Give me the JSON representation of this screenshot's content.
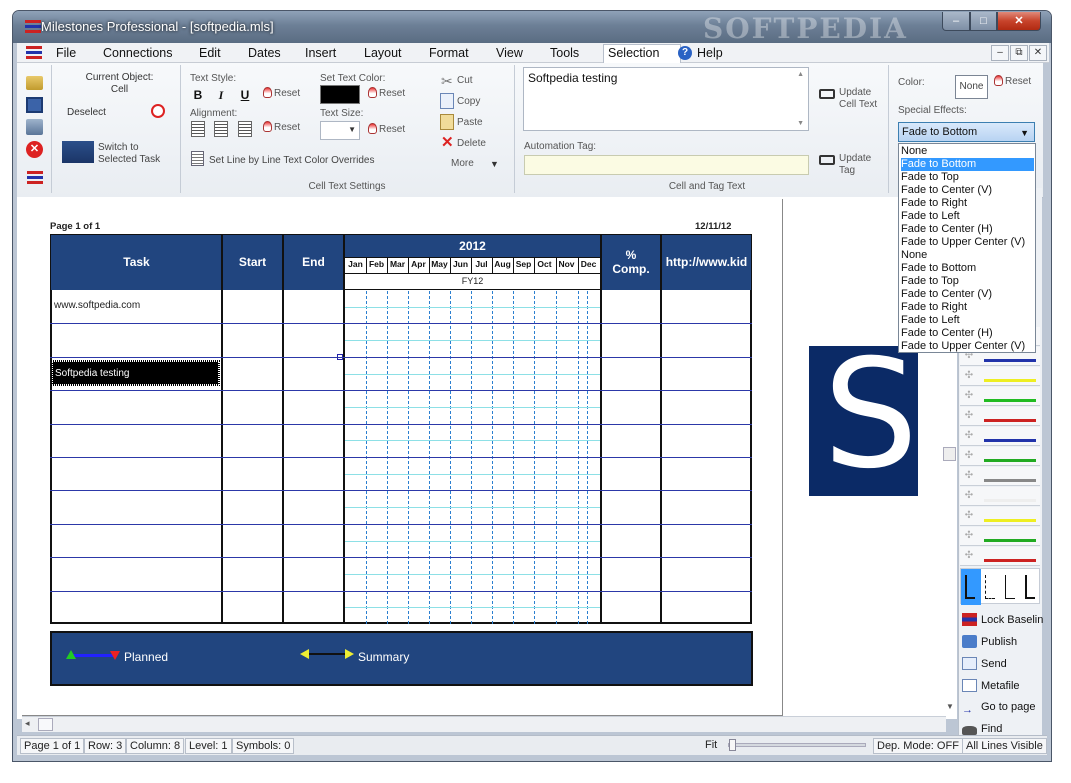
{
  "window": {
    "title": "Milestones Professional - [softpedia.mls]",
    "watermark": "SOFTPEDIA",
    "minimize": "‒",
    "maximize": "□",
    "close": "✕"
  },
  "menu": {
    "items": [
      "File",
      "Connections",
      "Edit",
      "Dates",
      "Insert",
      "Layout",
      "Format",
      "View",
      "Tools",
      "Selection",
      "Help"
    ]
  },
  "ribbon": {
    "current_object_label": "Current Object:",
    "current_object_value": "Cell",
    "deselect": "Deselect",
    "switch_task": [
      "Switch to",
      "Selected Task"
    ],
    "text_style": "Text Style:",
    "bold": "B",
    "italic": "I",
    "underline": "U",
    "reset": "Reset",
    "alignment": "Alignment:",
    "set_text_color": "Set Text Color:",
    "text_size": "Text Size:",
    "cut": "Cut",
    "copy": "Copy",
    "paste": "Paste",
    "delete": "Delete",
    "more": "More",
    "set_line_override": "Set Line by Line Text Color Overrides",
    "group_cell_text": "Cell Text Settings",
    "cell_text": "Softpedia testing",
    "update_cell_text": [
      "Update",
      "Cell Text"
    ],
    "automation_tag": "Automation Tag:",
    "update_tag": [
      "Update",
      "Tag"
    ],
    "group_cell_tag": "Cell and Tag Text",
    "color_label": "Color:",
    "color_value": "None",
    "special_effects": "Special Effects:",
    "special_effect_value": "Fade to Bottom"
  },
  "dropdown": {
    "items": [
      "None",
      "Fade to Bottom",
      "Fade to Top",
      "Fade to Center (V)",
      "Fade to Right",
      "Fade to Left",
      "Fade to Center (H)",
      "Fade to Upper Center (V)",
      "None",
      "Fade to Bottom",
      "Fade to Top",
      "Fade to Center (V)",
      "Fade to Right",
      "Fade to Left",
      "Fade to Center (H)",
      "Fade to Upper Center (V)"
    ],
    "selected_index": 1
  },
  "chart": {
    "page_info": "Page 1 of 1",
    "date": "12/11/12",
    "headers": {
      "task": "Task",
      "start": "Start",
      "end": "End",
      "year": "2012",
      "pct": [
        "%",
        "Comp."
      ],
      "url": "http://www.kid"
    },
    "months": [
      "Jan",
      "Feb",
      "Mar",
      "Apr",
      "May",
      "Jun",
      "Jul",
      "Aug",
      "Sep",
      "Oct",
      "Nov",
      "Dec"
    ],
    "fiscal": "FY12",
    "rows": [
      "www.softpedia.com",
      "",
      "Softpedia testing",
      "",
      "",
      "",
      "",
      "",
      "",
      ""
    ],
    "selected_row": 2,
    "legend": [
      {
        "label": "Planned"
      },
      {
        "label": "Summary"
      }
    ]
  },
  "toolbox": {
    "commands": [
      "Lock Baselin",
      "Publish",
      "Send",
      "Metafile",
      "Go to page",
      "Find"
    ]
  },
  "status": {
    "page": "Page 1 of 1",
    "row": "Row: 3",
    "column": "Column: 8",
    "level": "Level: 1",
    "symbols": "Symbols: 0",
    "fit": "Fit",
    "dep_mode": "Dep. Mode: OFF",
    "lines": "All Lines Visible"
  },
  "colors": {
    "header_blue": "#21457f",
    "legend_blue": "#21457f",
    "selection_highlight": "#3399ff",
    "logo_blue": "#0b2a66"
  }
}
